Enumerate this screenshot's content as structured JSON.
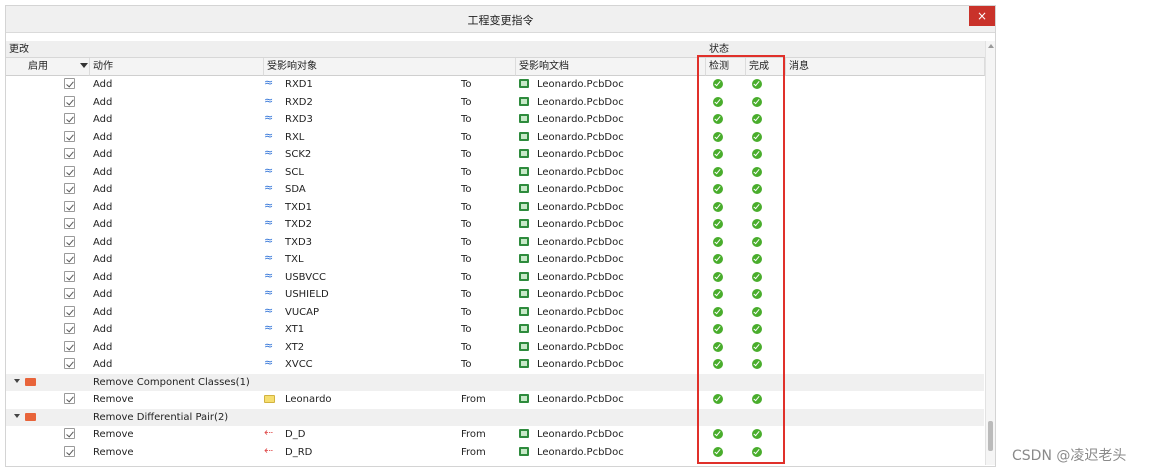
{
  "window": {
    "title": "工程变更指令",
    "close_label": "×"
  },
  "groups": {
    "changes": "更改",
    "status": "状态"
  },
  "columns": {
    "enable": "启用",
    "action": "动作",
    "affected_object": "受影响对象",
    "affected_document": "受影响文档",
    "check": "检测",
    "done": "完成",
    "message": "消息"
  },
  "rows": [
    {
      "type": "item",
      "action": "Add",
      "object": "RXD1",
      "dir": "To",
      "doc": "Leonardo.PcbDoc",
      "icon": "net"
    },
    {
      "type": "item",
      "action": "Add",
      "object": "RXD2",
      "dir": "To",
      "doc": "Leonardo.PcbDoc",
      "icon": "net"
    },
    {
      "type": "item",
      "action": "Add",
      "object": "RXD3",
      "dir": "To",
      "doc": "Leonardo.PcbDoc",
      "icon": "net"
    },
    {
      "type": "item",
      "action": "Add",
      "object": "RXL",
      "dir": "To",
      "doc": "Leonardo.PcbDoc",
      "icon": "net"
    },
    {
      "type": "item",
      "action": "Add",
      "object": "SCK2",
      "dir": "To",
      "doc": "Leonardo.PcbDoc",
      "icon": "net"
    },
    {
      "type": "item",
      "action": "Add",
      "object": "SCL",
      "dir": "To",
      "doc": "Leonardo.PcbDoc",
      "icon": "net"
    },
    {
      "type": "item",
      "action": "Add",
      "object": "SDA",
      "dir": "To",
      "doc": "Leonardo.PcbDoc",
      "icon": "net"
    },
    {
      "type": "item",
      "action": "Add",
      "object": "TXD1",
      "dir": "To",
      "doc": "Leonardo.PcbDoc",
      "icon": "net"
    },
    {
      "type": "item",
      "action": "Add",
      "object": "TXD2",
      "dir": "To",
      "doc": "Leonardo.PcbDoc",
      "icon": "net"
    },
    {
      "type": "item",
      "action": "Add",
      "object": "TXD3",
      "dir": "To",
      "doc": "Leonardo.PcbDoc",
      "icon": "net"
    },
    {
      "type": "item",
      "action": "Add",
      "object": "TXL",
      "dir": "To",
      "doc": "Leonardo.PcbDoc",
      "icon": "net"
    },
    {
      "type": "item",
      "action": "Add",
      "object": "USBVCC",
      "dir": "To",
      "doc": "Leonardo.PcbDoc",
      "icon": "net"
    },
    {
      "type": "item",
      "action": "Add",
      "object": "USHIELD",
      "dir": "To",
      "doc": "Leonardo.PcbDoc",
      "icon": "net"
    },
    {
      "type": "item",
      "action": "Add",
      "object": "VUCAP",
      "dir": "To",
      "doc": "Leonardo.PcbDoc",
      "icon": "net"
    },
    {
      "type": "item",
      "action": "Add",
      "object": "XT1",
      "dir": "To",
      "doc": "Leonardo.PcbDoc",
      "icon": "net"
    },
    {
      "type": "item",
      "action": "Add",
      "object": "XT2",
      "dir": "To",
      "doc": "Leonardo.PcbDoc",
      "icon": "net"
    },
    {
      "type": "item",
      "action": "Add",
      "object": "XVCC",
      "dir": "To",
      "doc": "Leonardo.PcbDoc",
      "icon": "net"
    },
    {
      "type": "group",
      "label": "Remove Component Classes(1)"
    },
    {
      "type": "item",
      "action": "Remove",
      "object": "Leonardo",
      "dir": "From",
      "doc": "Leonardo.PcbDoc",
      "icon": "folder"
    },
    {
      "type": "group",
      "label": "Remove Differential Pair(2)"
    },
    {
      "type": "item",
      "action": "Remove",
      "object": "D_D",
      "dir": "From",
      "doc": "Leonardo.PcbDoc",
      "icon": "pair"
    },
    {
      "type": "item",
      "action": "Remove",
      "object": "D_RD",
      "dir": "From",
      "doc": "Leonardo.PcbDoc",
      "icon": "pair"
    }
  ],
  "icons": {
    "net": "net-wave-icon",
    "pair": "diff-pair-icon",
    "folder": "folder-icon",
    "doc": "pcb-doc-icon",
    "ok": "check-ok-icon"
  },
  "colors": {
    "ok": "#49ad2c",
    "highlight": "#e0302a",
    "close": "#c9322a"
  },
  "watermark": "CSDN @凌迟老头"
}
